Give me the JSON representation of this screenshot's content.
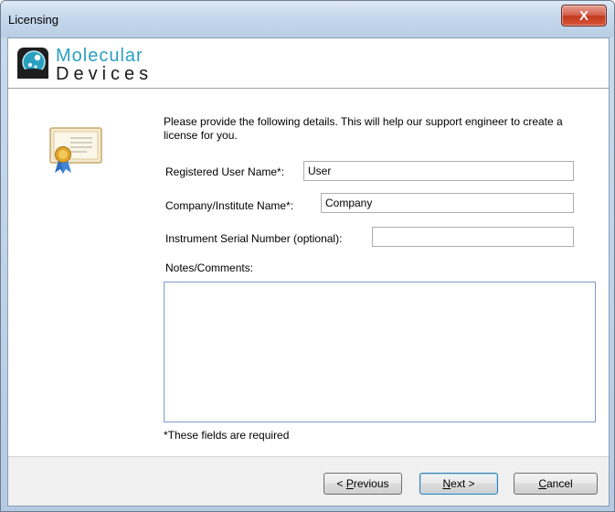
{
  "window": {
    "title": "Licensing",
    "close_glyph": "X"
  },
  "brand": {
    "line1": "Molecular",
    "line2": "Devices",
    "icon": "molecular-devices-logo-icon"
  },
  "intro_text": "Please provide the following details. This will help our support engineer to create a license for you.",
  "form": {
    "user_label": "Registered User Name*:",
    "user_value": "User",
    "company_label": "Company/Institute Name*:",
    "company_value": "Company",
    "serial_label": "Instrument Serial Number (optional):",
    "serial_value": "",
    "notes_label": "Notes/Comments:",
    "notes_value": "",
    "required_note": "*These fields are required"
  },
  "buttons": {
    "previous_prefix": "< ",
    "previous_mnemonic": "P",
    "previous_rest": "revious",
    "next_mnemonic": "N",
    "next_rest": "ext >",
    "cancel_mnemonic": "C",
    "cancel_rest": "ancel"
  },
  "icons": {
    "certificate": "certificate-icon"
  },
  "colors": {
    "accent": "#2aa0c0",
    "close_button": "#c43a1e",
    "title_bar": "#c6d8ec"
  }
}
